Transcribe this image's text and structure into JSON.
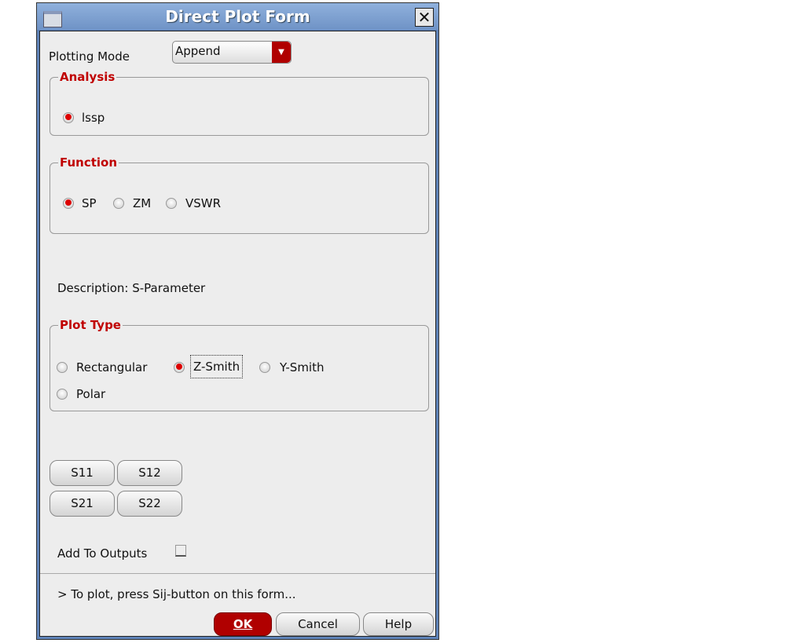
{
  "title": "Direct Plot Form",
  "plotting_mode": {
    "label": "Plotting Mode",
    "value": "Append"
  },
  "analysis": {
    "title": "Analysis",
    "options": [
      "lssp"
    ],
    "selected": "lssp"
  },
  "function": {
    "title": "Function",
    "options": [
      "SP",
      "ZM",
      "VSWR"
    ],
    "selected": "SP"
  },
  "description": "Description: S-Parameter",
  "plot_type": {
    "title": "Plot Type",
    "options": [
      "Rectangular",
      "Z-Smith",
      "Y-Smith",
      "Polar"
    ],
    "selected": "Z-Smith"
  },
  "sbuttons": [
    "S11",
    "S12",
    "S21",
    "S22"
  ],
  "add_to_outputs": {
    "label": "Add To Outputs",
    "checked": false
  },
  "status": "> To plot, press Sij-button on this form...",
  "buttons": {
    "ok": "OK",
    "cancel": "Cancel",
    "help": "Help"
  }
}
